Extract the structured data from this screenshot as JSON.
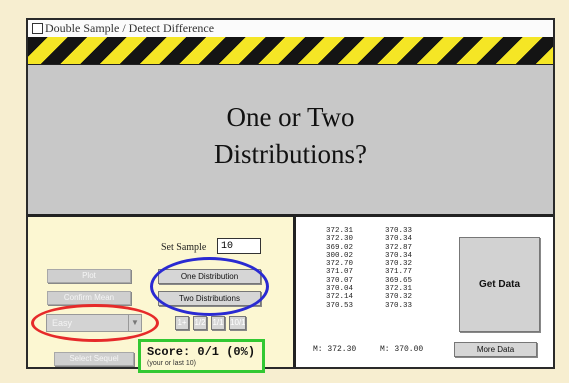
{
  "window": {
    "title": "Double Sample / Detect Difference",
    "banner": {
      "line1": "One or Two",
      "line2": "Distributions?"
    }
  },
  "controls": {
    "sample_size_label": "Set Sample",
    "sample_size_value": "10",
    "left_buttons": [
      "Plot",
      "Confirm Mean",
      "Select Sequel"
    ],
    "one_distribution": "One Distribution",
    "two_distributions": "Two Distributions",
    "difficulty": "Easy",
    "step_buttons": [
      "1+",
      "1/2",
      "1/1",
      "10/1"
    ]
  },
  "score": {
    "text": "Score:  0/1 (0%)",
    "sub": "(your or last 10)"
  },
  "data": {
    "col1": [
      "372.31",
      "372.30",
      "369.02",
      "300.02",
      "372.70",
      "371.07",
      "370.07",
      "370.04",
      "372.14",
      "370.53"
    ],
    "col2": [
      "370.33",
      "370.34",
      "372.87",
      "370.34",
      "370.32",
      "371.77",
      "369.65",
      "372.31",
      "370.32",
      "370.33"
    ],
    "mean1": "M:  372.30",
    "mean2": "M:  370.00",
    "get_data": "Get Data",
    "more_data": "More Data"
  },
  "colors": {
    "stripe_yellow": "#f5e625",
    "highlight_blue": "#2a2ad2",
    "highlight_red": "#e62a2a",
    "highlight_green": "#32c832"
  },
  "icons": {
    "close": "close-box-icon",
    "dropdown": "chevron-down-icon"
  }
}
